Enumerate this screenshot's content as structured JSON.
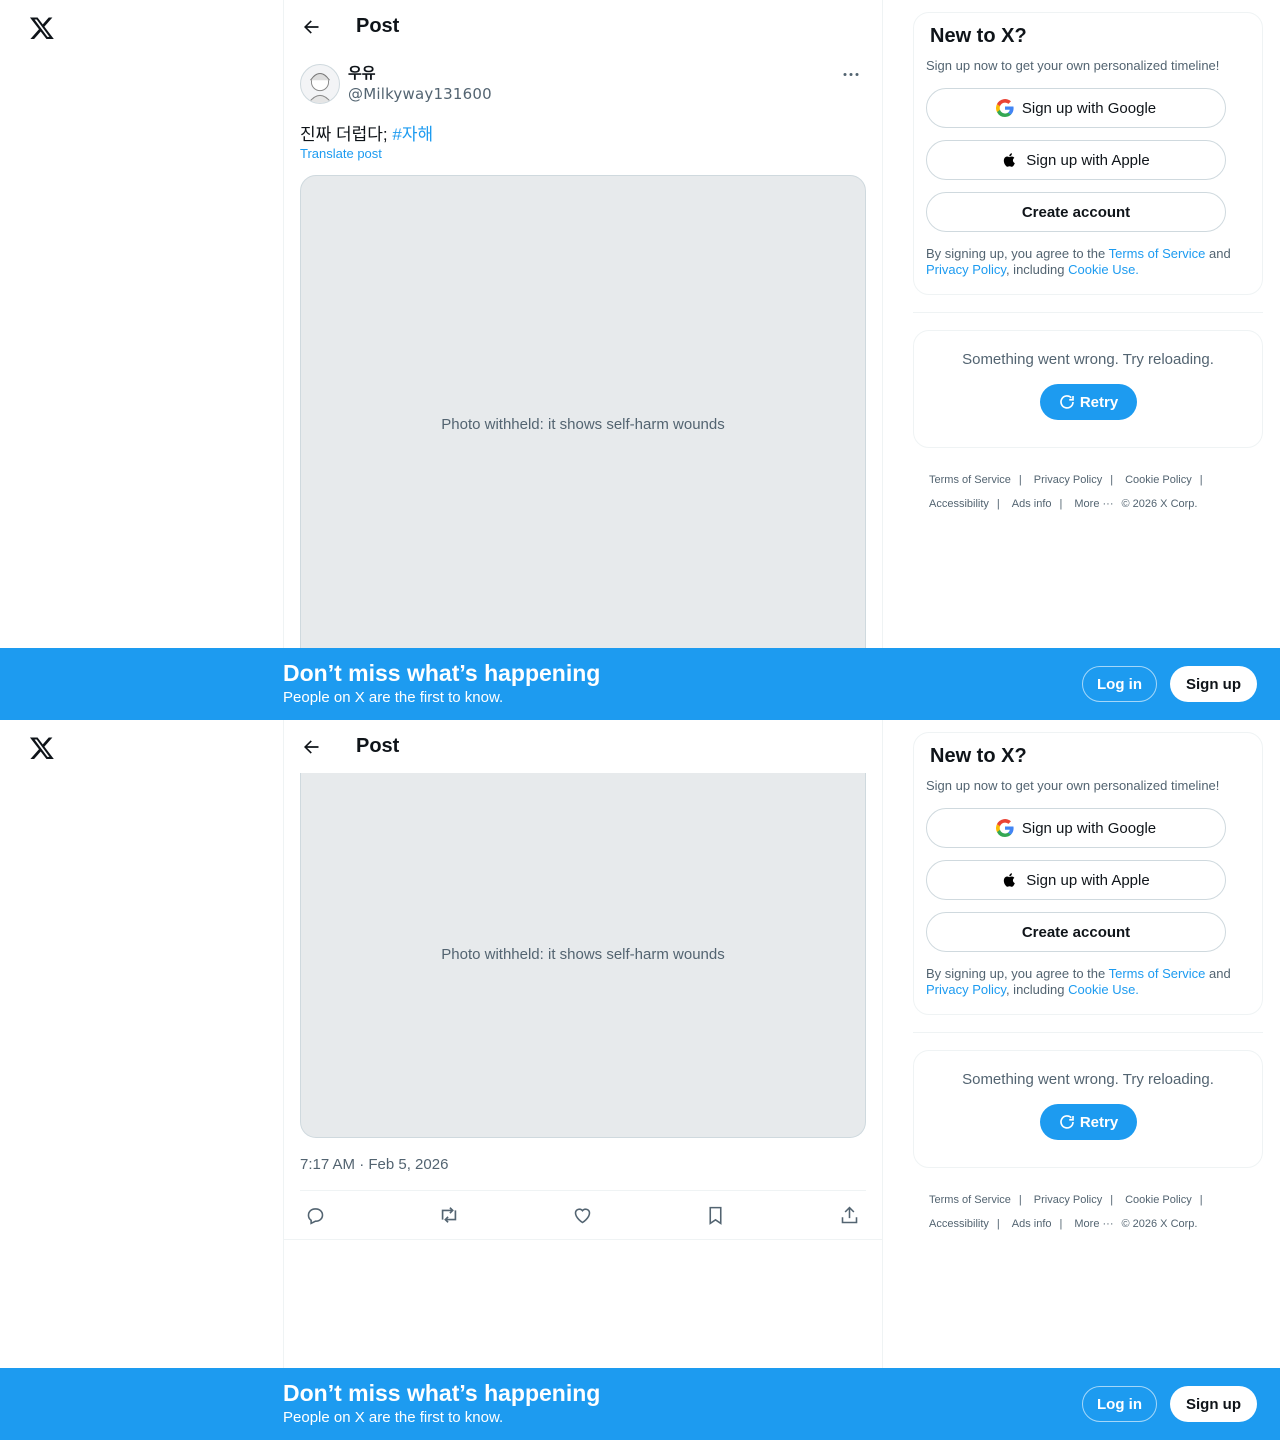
{
  "nav": {
    "logo": "x-logo-icon"
  },
  "header": {
    "title": "Post",
    "back_icon": "arrow-left-icon"
  },
  "post": {
    "author_name": "우유",
    "author_handle": "@Milkyway131600",
    "text": "진짜 더럽다; ",
    "hashtag": "#자해",
    "translate_label": "Translate post",
    "timestamp": "7:17 AM · Feb 5, 2026",
    "media_note": "Photo withheld: it shows self-harm wounds",
    "actions": [
      "reply-icon",
      "repost-icon",
      "like-icon",
      "bookmark-icon",
      "share-icon"
    ]
  },
  "sidebar": {
    "signup_card": {
      "title": "New to X?",
      "subtitle": "Sign up now to get your own personalized timeline!",
      "google": "Sign up with Google",
      "apple": "Sign up with Apple",
      "create": "Create account",
      "legal_prefix": "By signing up, you agree to the ",
      "terms": "Terms of Service",
      "and": " and ",
      "privacy": "Privacy Policy",
      "including": ", including ",
      "cookie": "Cookie Use."
    },
    "error": {
      "message": "Something went wrong. Try reloading.",
      "retry": "Retry"
    },
    "footer": {
      "terms": "Terms of Service",
      "privacy": "Privacy Policy",
      "cookie": "Cookie Policy",
      "accessibility": "Accessibility",
      "ads": "Ads info",
      "more": "More ···",
      "copyright": "© 2026 X Corp."
    }
  },
  "banner": {
    "headline": "Don’t miss what’s happening",
    "subline": "People on X are the first to know.",
    "login": "Log in",
    "signup": "Sign up"
  },
  "colors": {
    "accent": "#1d9bf0",
    "text": "#0f1419",
    "muted": "#536471",
    "border": "#eff3f4"
  }
}
